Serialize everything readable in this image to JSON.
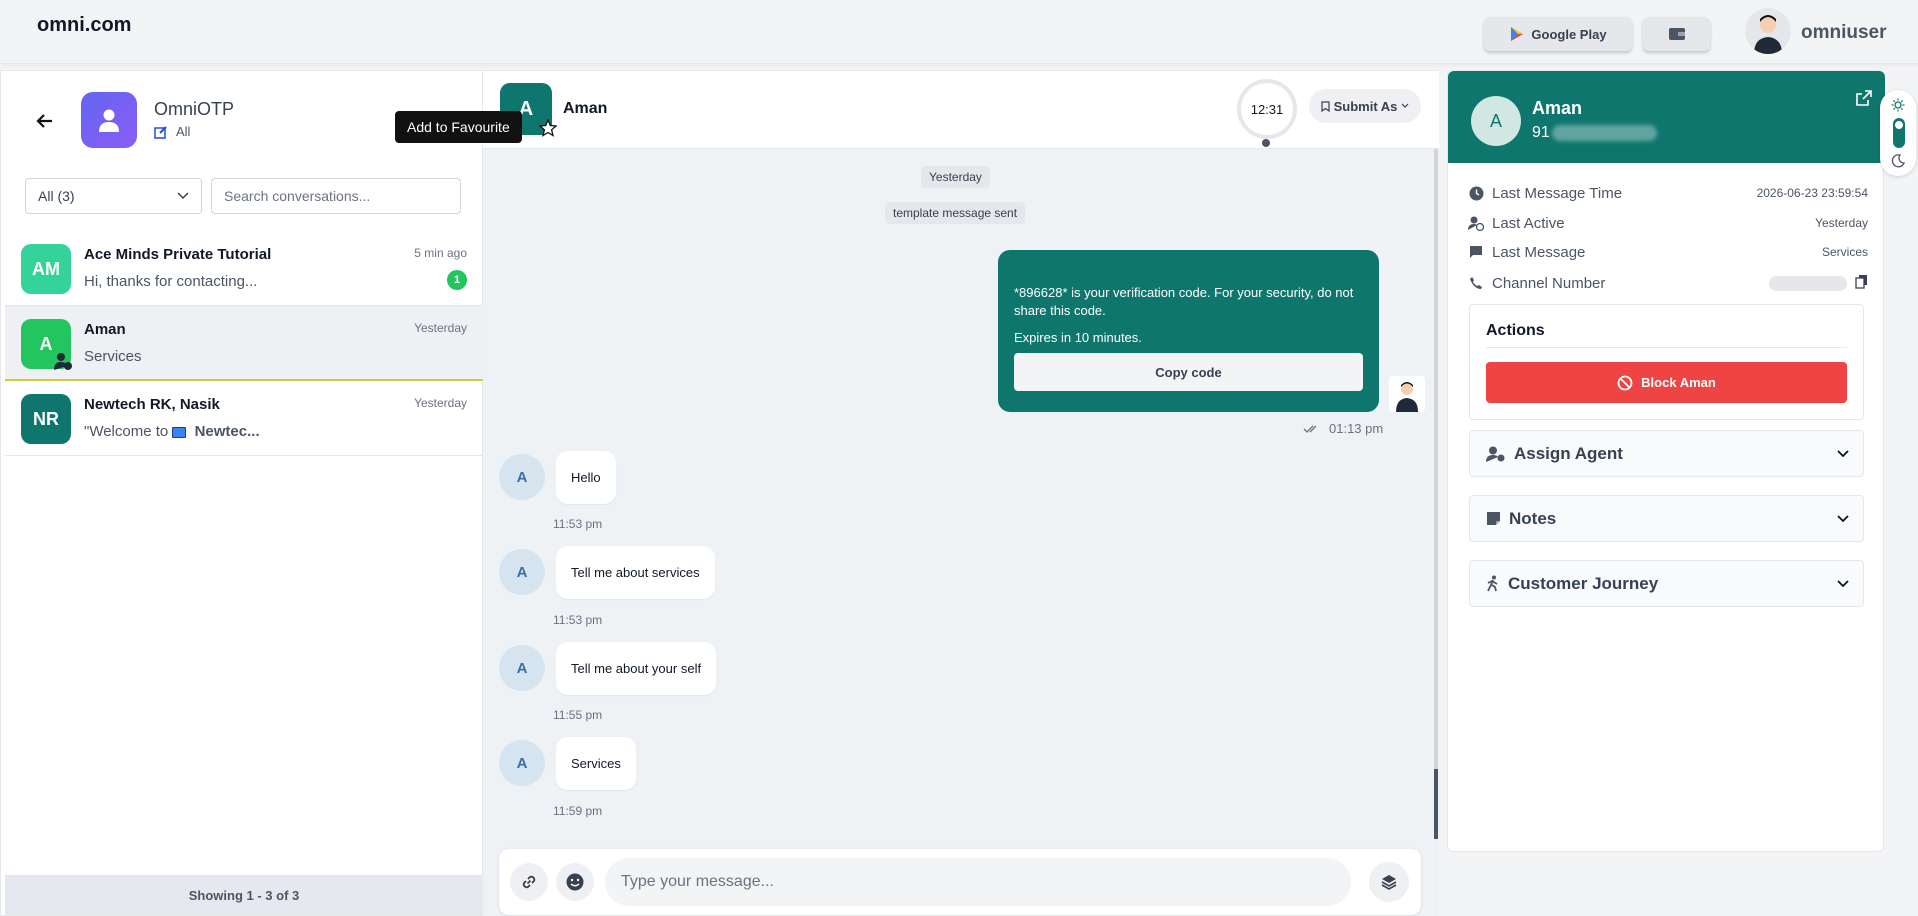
{
  "topbar": {
    "brand": "omni.com",
    "google_play_label": "Google Play",
    "user_name": "omniuser"
  },
  "left": {
    "account_name": "OmniOTP",
    "account_filter": "All",
    "tooltip": "Add to Favourite",
    "filter_select": "All (3)",
    "search_placeholder": "Search conversations...",
    "conversations": [
      {
        "initials": "AM",
        "name": "Ace Minds Private Tutorial",
        "message": "Hi, thanks for contacting...",
        "time": "5 min ago",
        "badge": "1",
        "color": "#34d399"
      },
      {
        "initials": "A",
        "name": "Aman",
        "message": "Services",
        "time": "Yesterday",
        "color": "#22c55e"
      },
      {
        "initials": "NR",
        "name": "Newtech RK, Nasik",
        "message_prefix": "\"Welcome to ",
        "message_bold": "Newtec...",
        "time": "Yesterday",
        "color": "#0f766e"
      }
    ],
    "footer": "Showing 1 - 3 of 3"
  },
  "chat": {
    "contact_initial": "A",
    "contact_name": "Aman",
    "timer": "12:31",
    "submit_label": "Submit As",
    "date_pill": "Yesterday",
    "system_pill": "template message sent",
    "template": {
      "text": "*896628* is your verification code. For your security, do not share this code.",
      "expires": "Expires in 10 minutes.",
      "button": "Copy code",
      "time": "01:13 pm"
    },
    "messages": [
      {
        "text": "Hello",
        "time": "11:53 pm"
      },
      {
        "text": "Tell me about services",
        "time": "11:53 pm"
      },
      {
        "text": "Tell me about your self",
        "time": "11:55 pm"
      },
      {
        "text": "Services",
        "time": "11:59 pm"
      }
    ],
    "composer_placeholder": "Type your message..."
  },
  "right": {
    "initial": "A",
    "name": "Aman",
    "phone_prefix": "91",
    "info": [
      {
        "label": "Last Message Time",
        "value": "2026-06-23 23:59:54",
        "icon": "clock-icon"
      },
      {
        "label": "Last Active",
        "value": "Yesterday",
        "icon": "user-clock-icon"
      },
      {
        "label": "Last Message",
        "value": "Services",
        "icon": "message-icon"
      },
      {
        "label": "Channel Number",
        "value": "",
        "icon": "phone-icon"
      }
    ],
    "actions_title": "Actions",
    "block_label": "Block Aman",
    "accordions": [
      "Assign Agent",
      "Notes",
      "Customer Journey"
    ]
  },
  "colors": {
    "accent": "#0f766e",
    "danger": "#ef4444",
    "badge": "#22c55e"
  }
}
